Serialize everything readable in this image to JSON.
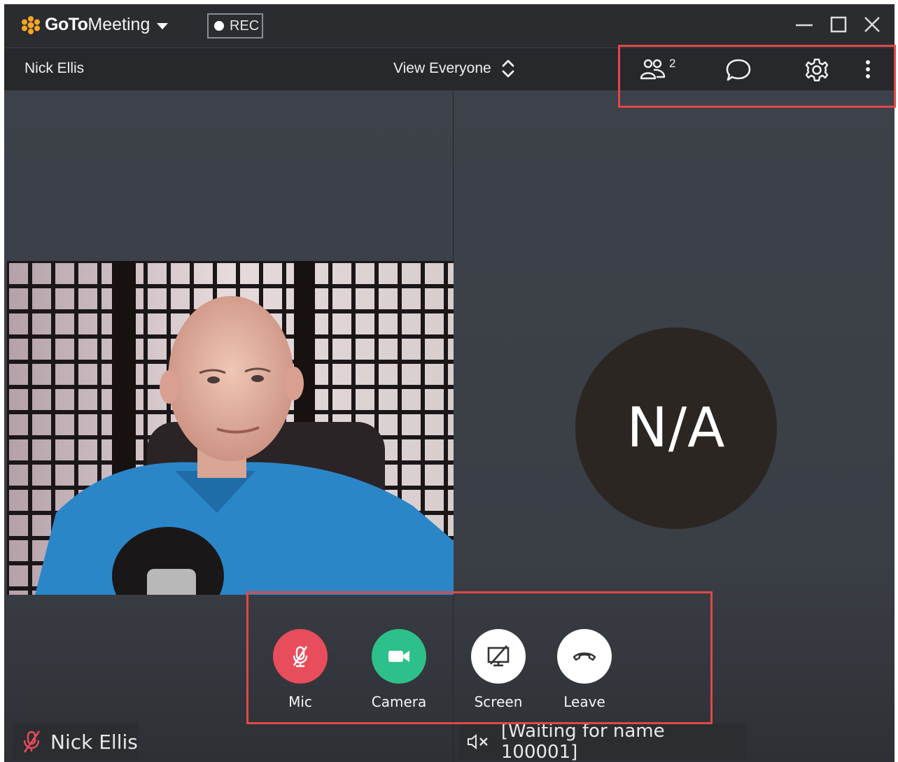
{
  "app": {
    "logo_bold": "GoTo",
    "logo_light": "Meeting",
    "rec_label": "REC"
  },
  "header": {
    "host_name": "Nick Ellis",
    "view_label": "View Everyone",
    "participant_count": "2"
  },
  "stage": {
    "avatar_initials": "N/A"
  },
  "controls": {
    "mic_label": "Mic",
    "camera_label": "Camera",
    "screen_label": "Screen",
    "leave_label": "Leave"
  },
  "tiles": {
    "left_name": "Nick Ellis",
    "right_name": "[Waiting for name 100001]"
  },
  "colors": {
    "mic_button": "#e84d5b",
    "camera_button": "#2ec08a",
    "screen_button": "#ffffff",
    "leave_button": "#ffffff",
    "logo_accent": "#f5a623",
    "highlight": "#e04848"
  },
  "icons": [
    "logo-star-icon",
    "rec-dot-icon",
    "minimize-icon",
    "maximize-icon",
    "close-icon",
    "sort-chevrons-icon",
    "participants-icon",
    "chat-icon",
    "gear-icon",
    "more-vertical-icon",
    "mic-muted-icon",
    "video-camera-icon",
    "screen-share-off-icon",
    "hang-up-icon",
    "speaker-muted-icon"
  ]
}
